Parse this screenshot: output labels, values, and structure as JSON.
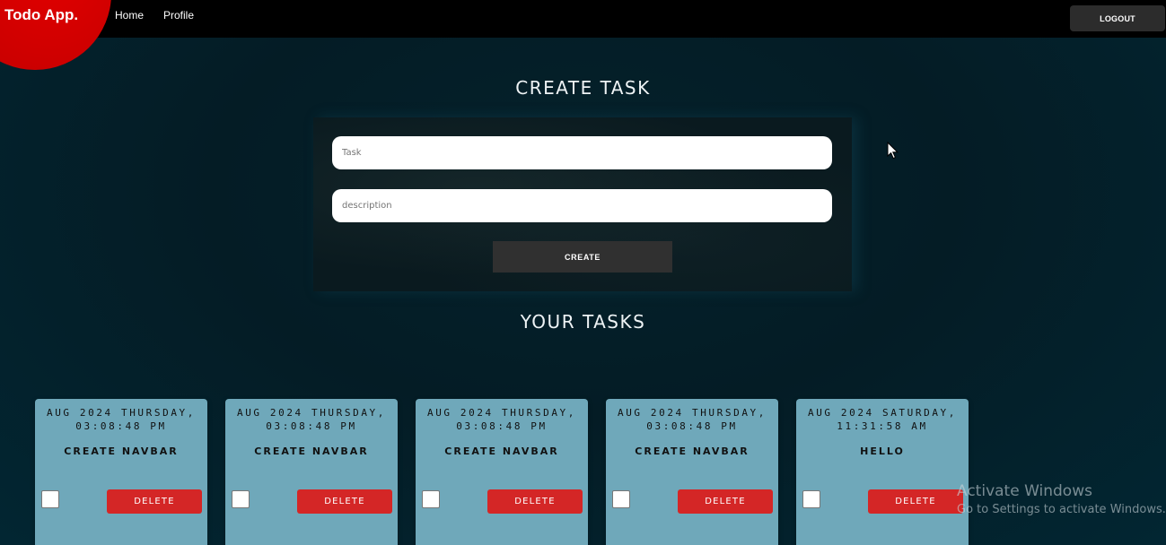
{
  "navbar": {
    "brand": "Todo App.",
    "links": [
      "Home",
      "Profile"
    ],
    "logout_label": "LOGOUT"
  },
  "create_section": {
    "title": "CREATE TASK",
    "task_placeholder": "Task",
    "description_placeholder": "description",
    "create_label": "CREATE"
  },
  "tasks_section": {
    "title": "YOUR TASKS",
    "delete_label": "DELETE",
    "tasks": [
      {
        "date_line1": "AUG 2024 THURSDAY,",
        "date_line2": "03:08:48 PM",
        "title": "CREATE NAVBAR",
        "checked": false
      },
      {
        "date_line1": "AUG 2024 THURSDAY,",
        "date_line2": "03:08:48 PM",
        "title": "CREATE NAVBAR",
        "checked": false
      },
      {
        "date_line1": "AUG 2024 THURSDAY,",
        "date_line2": "03:08:48 PM",
        "title": "CREATE NAVBAR",
        "checked": false
      },
      {
        "date_line1": "AUG 2024 THURSDAY,",
        "date_line2": "03:08:48 PM",
        "title": "CREATE NAVBAR",
        "checked": false
      },
      {
        "date_line1": "AUG 2024 SATURDAY,",
        "date_line2": "11:31:58 AM",
        "title": "HELLO",
        "checked": false
      }
    ]
  },
  "watermark": {
    "title": "Activate Windows",
    "subtitle": "Go to Settings to activate Windows."
  },
  "colors": {
    "brand_red": "#d10000",
    "card_bg": "#6fa8ba",
    "delete_red": "#d42626",
    "background": "#03202a"
  }
}
